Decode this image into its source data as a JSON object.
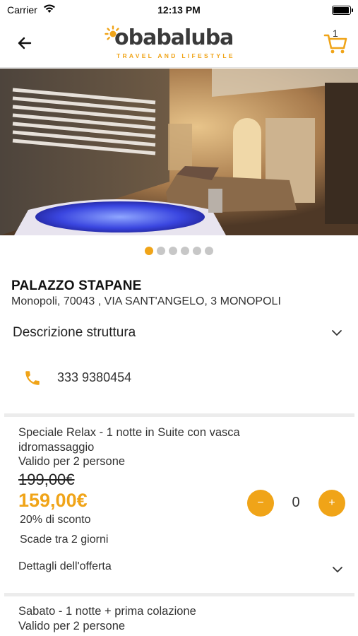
{
  "status_bar": {
    "carrier": "Carrier",
    "time": "12:13 PM"
  },
  "header": {
    "logo_text": "obabaluba",
    "logo_tagline": "TRAVEL AND LIFESTYLE",
    "cart_count": "1",
    "accent_color": "#f0a418"
  },
  "gallery": {
    "slide_count": 6,
    "active_index": 0
  },
  "property": {
    "name": "PALAZZO STAPANE",
    "address": "Monopoli, 70043 , VIA SANT'ANGELO, 3 MONOPOLI",
    "description_label": "Descrizione struttura",
    "phone": "333 9380454"
  },
  "offers": [
    {
      "title": "Speciale Relax - 1 notte in Suite con vasca idromassaggio",
      "valid": "Valido per 2 persone",
      "old_price": "199,00€",
      "new_price": "159,00€",
      "discount": "20% di sconto",
      "expiry": "Scade tra 2 giorni",
      "details_label": "Dettagli dell'offerta",
      "qty_minus": "−",
      "qty_plus": "+",
      "quantity": "0"
    },
    {
      "title": "Sabato - 1 notte + prima colazione",
      "valid": "Valido per 2 persone"
    }
  ]
}
